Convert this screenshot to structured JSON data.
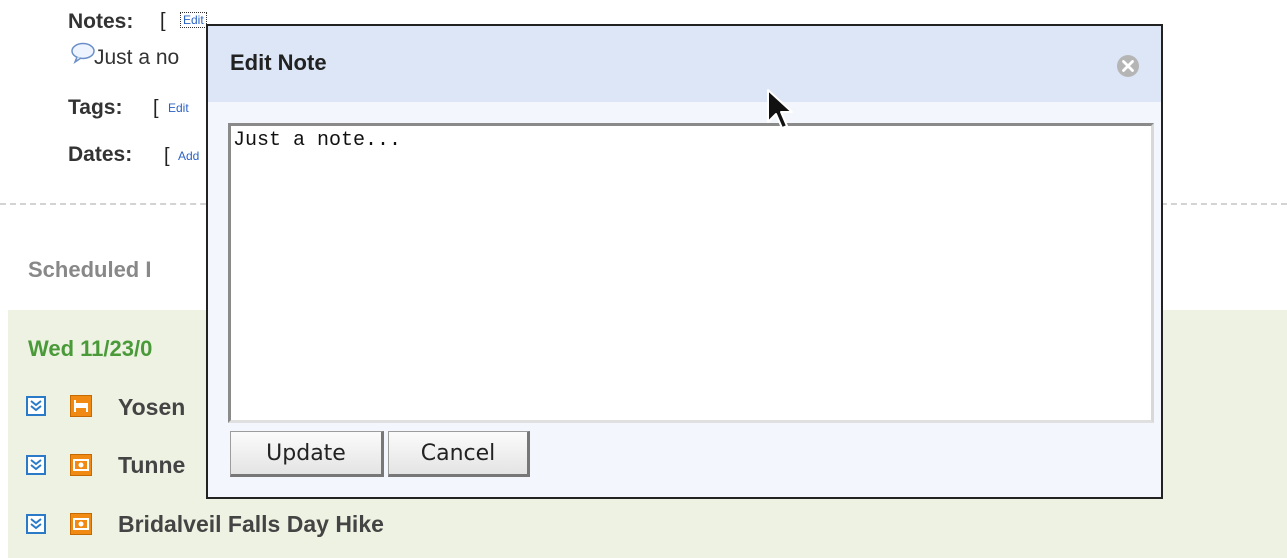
{
  "background": {
    "notes_label": "Notes:",
    "notes_edit_link": "Edit",
    "note_preview": "Just a no",
    "tags_label": "Tags:",
    "tags_link": "Edit",
    "dates_label": "Dates:",
    "dates_link": "Add",
    "scheduled_title": "Scheduled I",
    "date_heading": "Wed 11/23/0",
    "items": [
      {
        "text": "Yosen",
        "category": "lodging-icon"
      },
      {
        "text": "Tunne",
        "category": "camera-icon"
      },
      {
        "text": "Bridalveil Falls Day Hike",
        "category": "camera-icon"
      }
    ]
  },
  "dialog": {
    "title": "Edit Note",
    "note_text": "Just a note...",
    "update_label": "Update",
    "cancel_label": "Cancel"
  },
  "colors": {
    "accent_green": "#4a9a3a",
    "link_blue": "#2a63c4",
    "category_orange": "#f08a12",
    "dialog_header": "#dce6f6"
  }
}
